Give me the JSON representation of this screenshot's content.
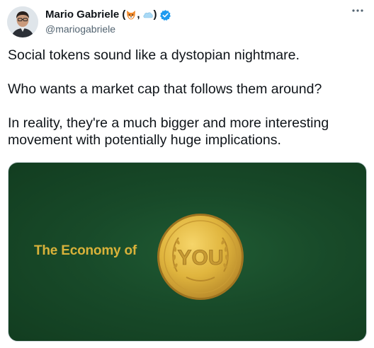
{
  "author": {
    "name_prefix": "Mario Gabriele (",
    "name_separator": ",",
    "name_suffix": ")",
    "handle": "@mariogabriele",
    "emoji_1": "fox-face-icon",
    "emoji_2": "cloud-icon",
    "verified_color": "#1d9bf0"
  },
  "tweet": {
    "paragraphs": [
      "Social tokens sound like a dystopian nightmare.",
      "Who wants a market cap that follows them around?",
      "In reality, they're a much bigger and more interesting movement with potentially huge implications."
    ]
  },
  "media": {
    "headline": "The Economy of",
    "coin_text": "YOU",
    "background_color": "#184a29",
    "accent_color": "#d9b23a"
  }
}
